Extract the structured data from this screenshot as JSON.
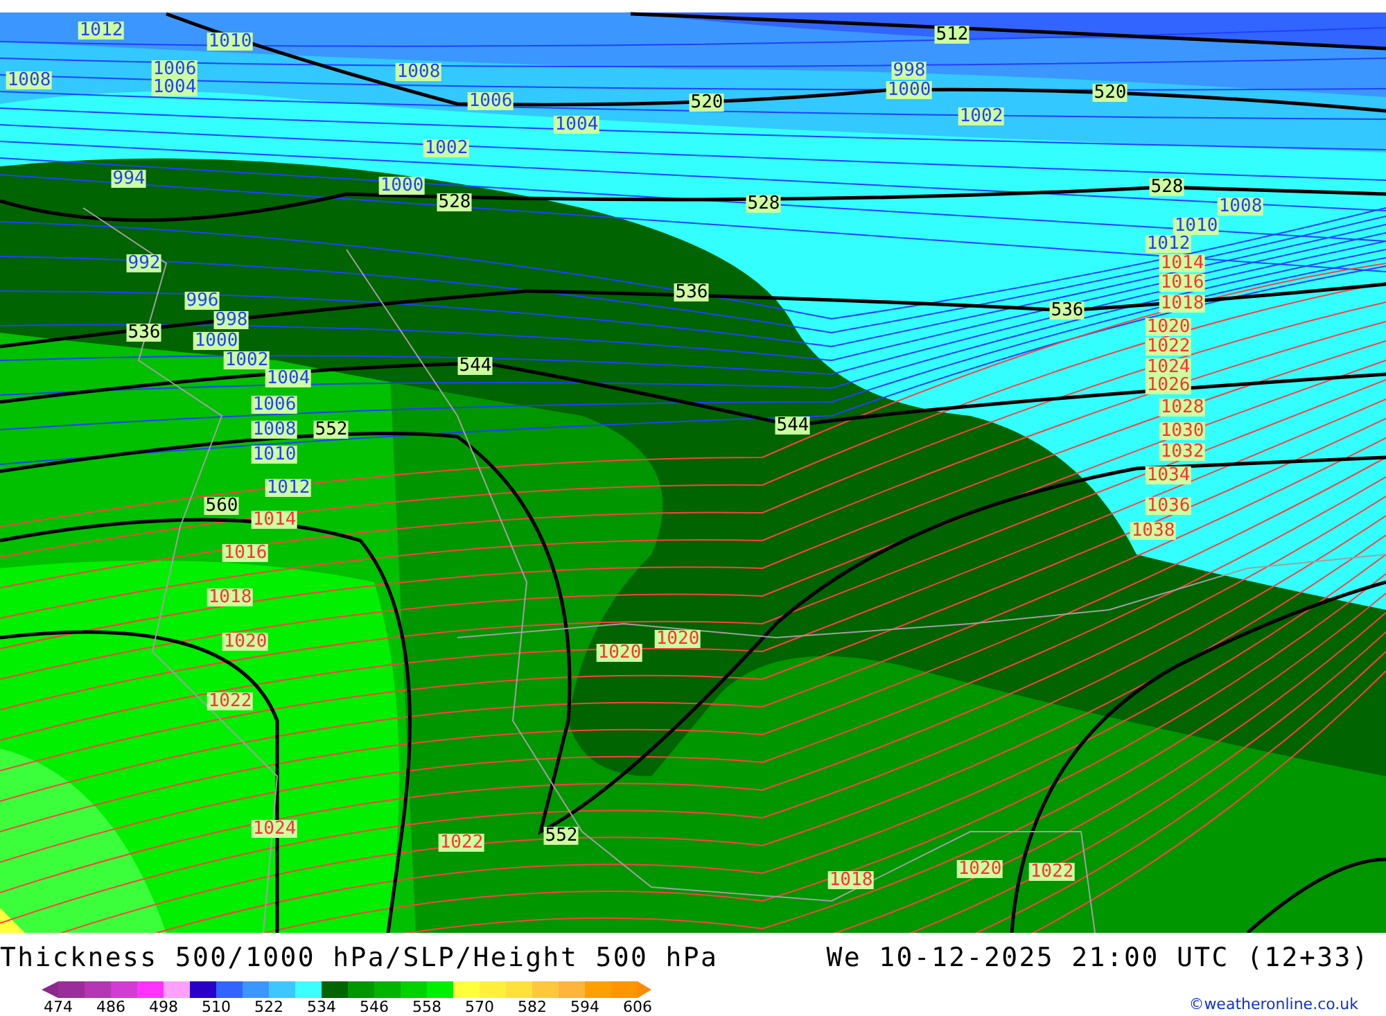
{
  "map": {
    "labels": [
      {
        "text": "1012",
        "kind": "isobar_low"
      },
      {
        "text": "1010",
        "kind": "isobar_low"
      },
      {
        "text": "512",
        "kind": "thickness"
      },
      {
        "text": "1008",
        "kind": "isobar_low"
      },
      {
        "text": "1006",
        "kind": "isobar_low"
      },
      {
        "text": "1008",
        "kind": "isobar_low"
      },
      {
        "text": "998",
        "kind": "isobar_low"
      },
      {
        "text": "1004",
        "kind": "isobar_low"
      },
      {
        "text": "1000",
        "kind": "isobar_low"
      },
      {
        "text": "520",
        "kind": "thickness"
      },
      {
        "text": "1006",
        "kind": "isobar_low"
      },
      {
        "text": "520",
        "kind": "thickness"
      },
      {
        "text": "1002",
        "kind": "isobar_low"
      },
      {
        "text": "1004",
        "kind": "isobar_low"
      },
      {
        "text": "1002",
        "kind": "isobar_low"
      },
      {
        "text": "994",
        "kind": "isobar_low"
      },
      {
        "text": "1000",
        "kind": "isobar_low"
      },
      {
        "text": "528",
        "kind": "thickness"
      },
      {
        "text": "528",
        "kind": "thickness"
      },
      {
        "text": "528",
        "kind": "thickness"
      },
      {
        "text": "1008",
        "kind": "isobar_low"
      },
      {
        "text": "1010",
        "kind": "isobar_low"
      },
      {
        "text": "1012",
        "kind": "isobar_low"
      },
      {
        "text": "992",
        "kind": "isobar_low"
      },
      {
        "text": "1014",
        "kind": "isobar_high"
      },
      {
        "text": "1016",
        "kind": "isobar_high"
      },
      {
        "text": "536",
        "kind": "thickness"
      },
      {
        "text": "996",
        "kind": "isobar_low"
      },
      {
        "text": "1018",
        "kind": "isobar_high"
      },
      {
        "text": "536",
        "kind": "thickness"
      },
      {
        "text": "998",
        "kind": "isobar_low"
      },
      {
        "text": "536",
        "kind": "thickness"
      },
      {
        "text": "1020",
        "kind": "isobar_high"
      },
      {
        "text": "1000",
        "kind": "isobar_low"
      },
      {
        "text": "1022",
        "kind": "isobar_high"
      },
      {
        "text": "1002",
        "kind": "isobar_low"
      },
      {
        "text": "544",
        "kind": "thickness"
      },
      {
        "text": "1024",
        "kind": "isobar_high"
      },
      {
        "text": "1004",
        "kind": "isobar_low"
      },
      {
        "text": "1026",
        "kind": "isobar_high"
      },
      {
        "text": "1006",
        "kind": "isobar_low"
      },
      {
        "text": "1028",
        "kind": "isobar_high"
      },
      {
        "text": "1008",
        "kind": "isobar_low"
      },
      {
        "text": "552",
        "kind": "thickness"
      },
      {
        "text": "544",
        "kind": "thickness"
      },
      {
        "text": "1030",
        "kind": "isobar_high"
      },
      {
        "text": "1010",
        "kind": "isobar_low"
      },
      {
        "text": "1032",
        "kind": "isobar_high"
      },
      {
        "text": "1034",
        "kind": "isobar_high"
      },
      {
        "text": "1012",
        "kind": "isobar_low"
      },
      {
        "text": "560",
        "kind": "thickness"
      },
      {
        "text": "1036",
        "kind": "isobar_high"
      },
      {
        "text": "1014",
        "kind": "isobar_high"
      },
      {
        "text": "1038",
        "kind": "isobar_high"
      },
      {
        "text": "1016",
        "kind": "isobar_high"
      },
      {
        "text": "1018",
        "kind": "isobar_high"
      },
      {
        "text": "1020",
        "kind": "isobar_high"
      },
      {
        "text": "1020",
        "kind": "isobar_high"
      },
      {
        "text": "1020",
        "kind": "isobar_high"
      },
      {
        "text": "1022",
        "kind": "isobar_high"
      },
      {
        "text": "1024",
        "kind": "isobar_high"
      },
      {
        "text": "1022",
        "kind": "isobar_high"
      },
      {
        "text": "552",
        "kind": "thickness"
      },
      {
        "text": "1018",
        "kind": "isobar_high"
      },
      {
        "text": "1020",
        "kind": "isobar_high"
      },
      {
        "text": "1022",
        "kind": "isobar_high"
      }
    ]
  },
  "title": "Thickness 500/1000 hPa/SLP/Height 500 hPa",
  "valid_time": "We 10-12-2025 21:00 UTC (12+33)",
  "legend": {
    "items": [
      {
        "kind": "arrow",
        "color": "#8c288c"
      },
      {
        "kind": "cell",
        "color": "#9b2d9b"
      },
      {
        "kind": "cell",
        "color": "#b436b4"
      },
      {
        "kind": "cell",
        "color": "#d23cd2"
      },
      {
        "kind": "cell",
        "color": "#ff32ff"
      },
      {
        "kind": "cell",
        "color": "#ffa0ff"
      },
      {
        "kind": "cell",
        "color": "#2800c8"
      },
      {
        "kind": "cell",
        "color": "#3264ff"
      },
      {
        "kind": "cell",
        "color": "#3c96ff"
      },
      {
        "kind": "cell",
        "color": "#3cc8ff"
      },
      {
        "kind": "cell",
        "color": "#3cffff"
      },
      {
        "kind": "cell",
        "color": "#006400"
      },
      {
        "kind": "cell",
        "color": "#009600"
      },
      {
        "kind": "cell",
        "color": "#00b400"
      },
      {
        "kind": "cell",
        "color": "#00d200"
      },
      {
        "kind": "cell",
        "color": "#00f000"
      },
      {
        "kind": "cell",
        "color": "#ffff3c"
      },
      {
        "kind": "cell",
        "color": "#fff03c"
      },
      {
        "kind": "cell",
        "color": "#ffe13c"
      },
      {
        "kind": "cell",
        "color": "#ffc83c"
      },
      {
        "kind": "cell",
        "color": "#ffb43c"
      },
      {
        "kind": "cell",
        "color": "#ffa000"
      },
      {
        "kind": "cell",
        "color": "#ff9600"
      },
      {
        "kind": "arrow",
        "color": "#ff8c00"
      }
    ],
    "ticks": [
      "474",
      "486",
      "498",
      "510",
      "522",
      "534",
      "546",
      "558",
      "570",
      "582",
      "594",
      "606"
    ]
  },
  "credit": "©weatheronline.co.uk"
}
